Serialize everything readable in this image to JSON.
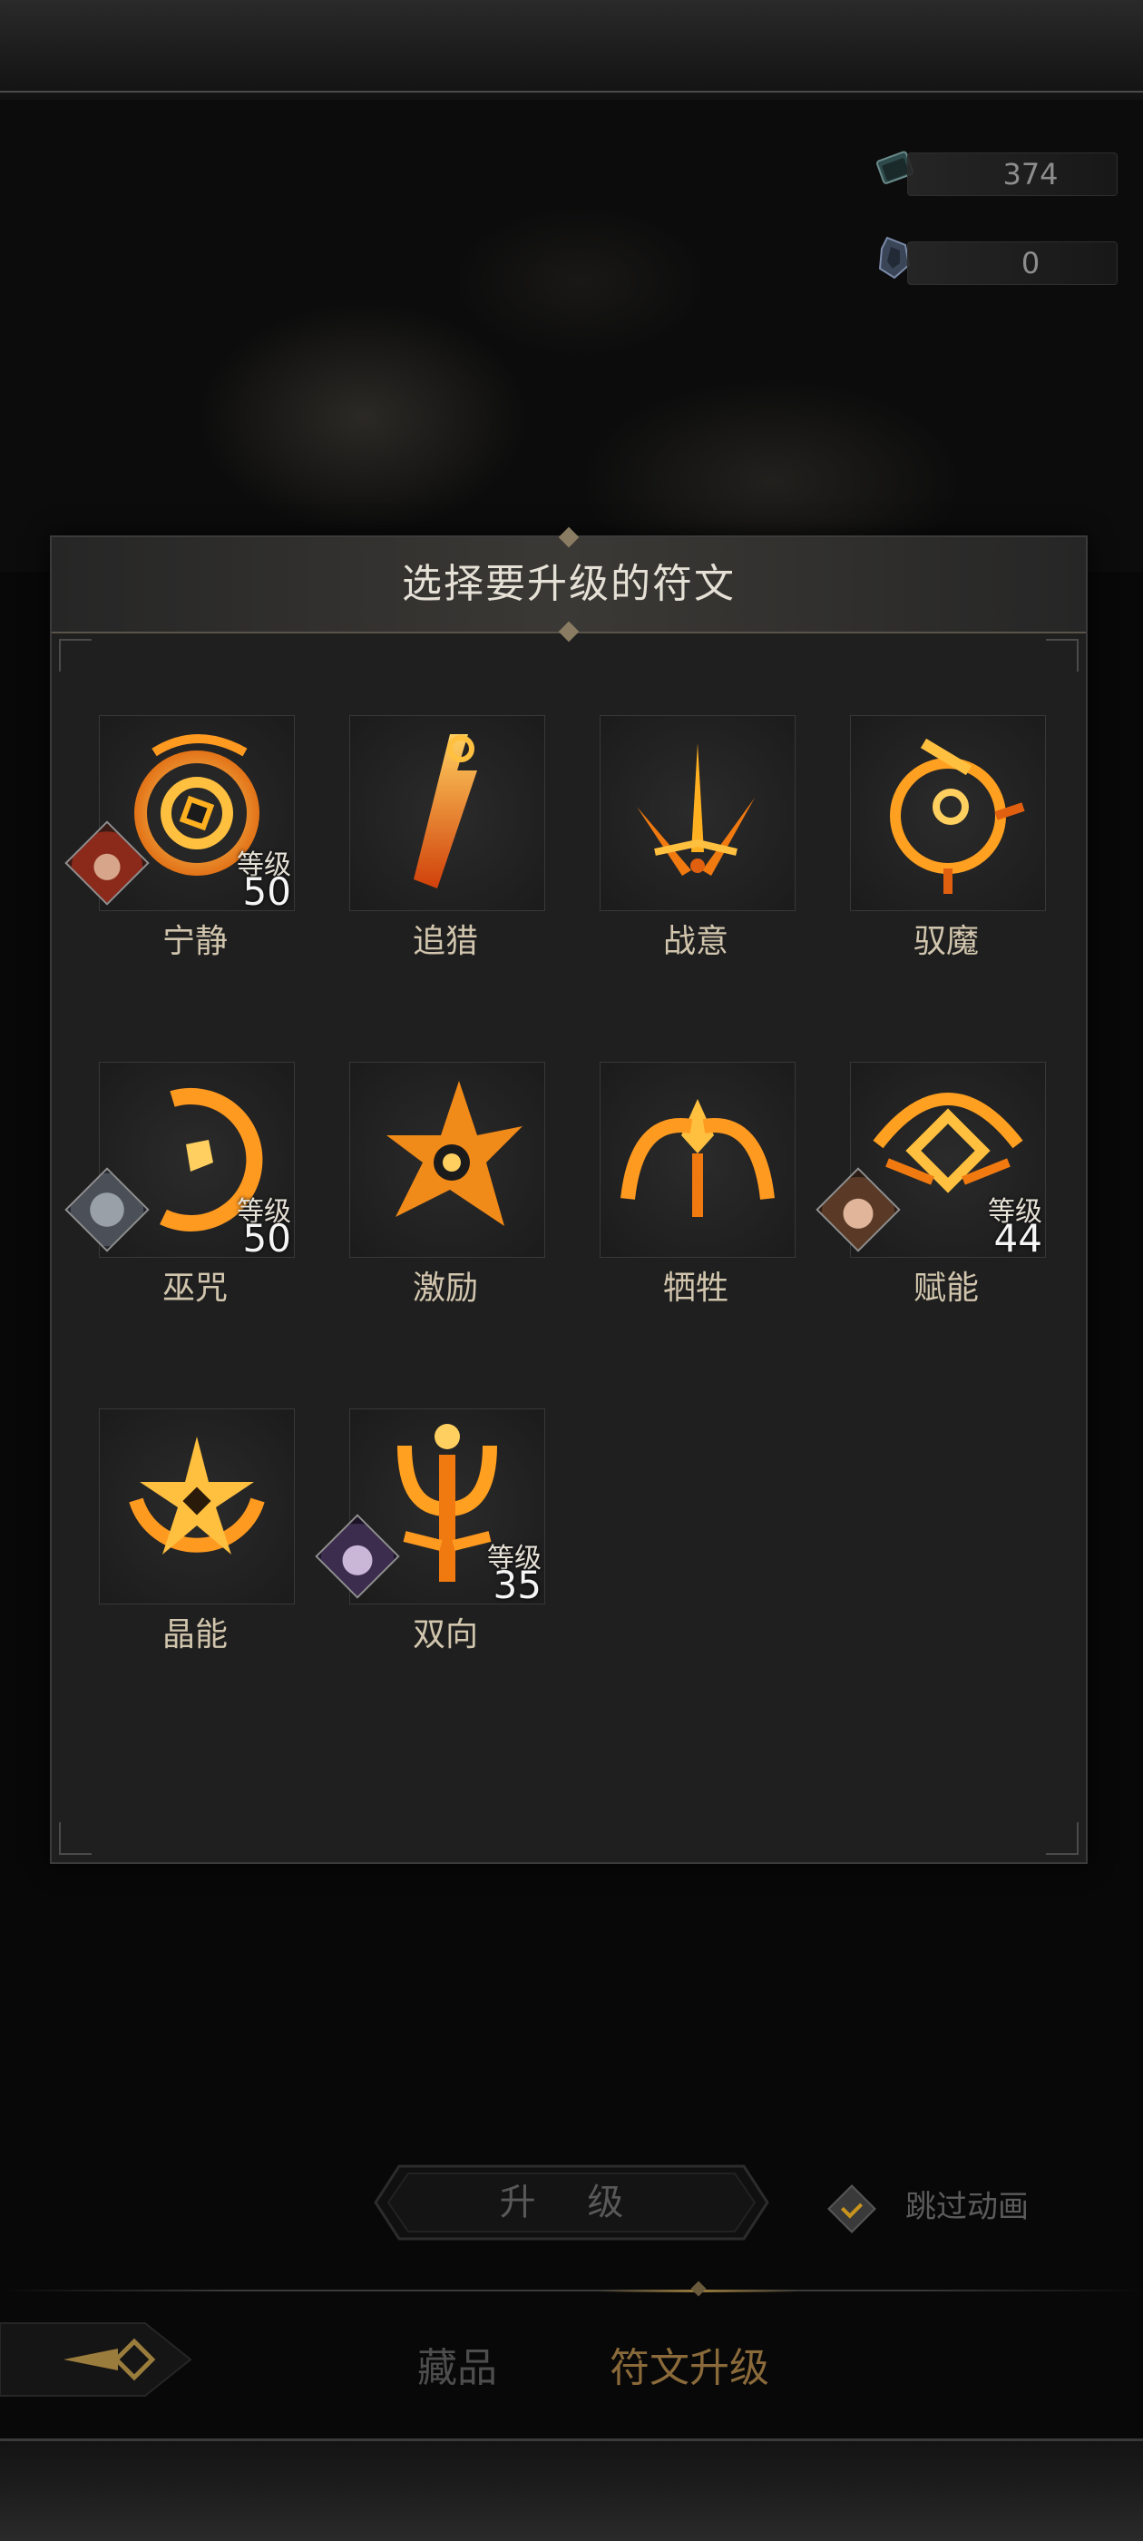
{
  "currencies": [
    {
      "icon": "rune-scroll-icon",
      "value": "374"
    },
    {
      "icon": "rune-fragment-icon",
      "value": "0"
    }
  ],
  "panel": {
    "title": "选择要升级的符文"
  },
  "level_label": "等级",
  "runes": [
    {
      "name": "宁静",
      "level": "50",
      "avatar": "red-hair-hero"
    },
    {
      "name": "追猎"
    },
    {
      "name": "战意"
    },
    {
      "name": "驭魔"
    },
    {
      "name": "巫咒",
      "level": "50",
      "avatar": "wolf-hero"
    },
    {
      "name": "激励"
    },
    {
      "name": "牺牲"
    },
    {
      "name": "赋能",
      "level": "44",
      "avatar": "brown-hair-hero"
    },
    {
      "name": "晶能"
    },
    {
      "name": "双向",
      "level": "35",
      "avatar": "elf-hero"
    }
  ],
  "actions": {
    "upgrade_label": "升 级",
    "skip_animation_label": "跳过动画"
  },
  "tabs": [
    {
      "label": "藏品",
      "active": false
    },
    {
      "label": "符文升级",
      "active": true
    }
  ],
  "colors": {
    "accent_gold": "#c9941e",
    "rune_glow": "#ffb020",
    "active_tab": "#8a6a3a",
    "inactive_tab": "#4d4d4d"
  }
}
